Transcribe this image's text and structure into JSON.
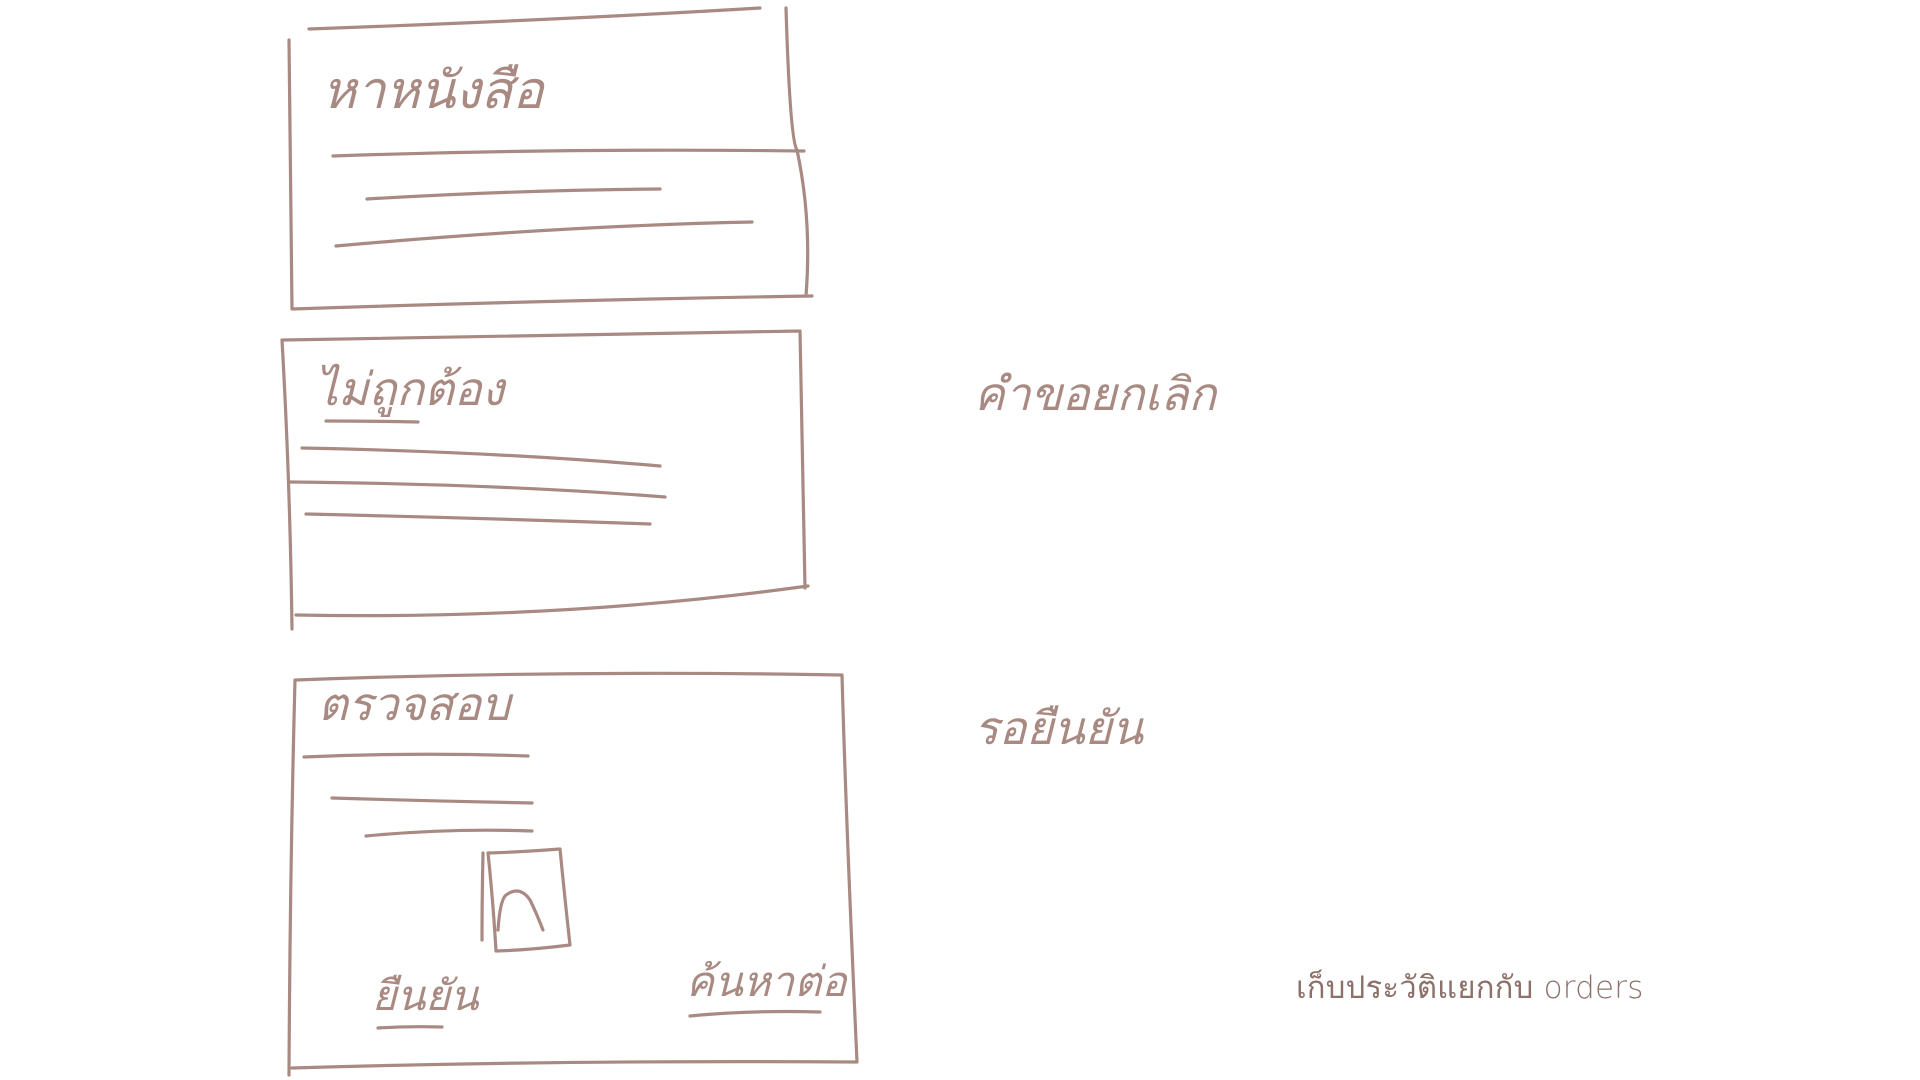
{
  "colors": {
    "ink": "#a88a82",
    "background": "#ffffff"
  },
  "frames": [
    {
      "title": "หาหนังสือ"
    },
    {
      "title": "ไม่ถูกต้อง"
    },
    {
      "title": "ตรวจสอบ",
      "left_action": "ยืนยัน",
      "right_action": "ค้นหาต่อ"
    }
  ],
  "side_labels": {
    "first": "คำขอยกเลิก",
    "second": "รอยืนยัน"
  },
  "note": "เก็บประวัติแยกกับ orders",
  "icons": {
    "book": "book-icon"
  }
}
